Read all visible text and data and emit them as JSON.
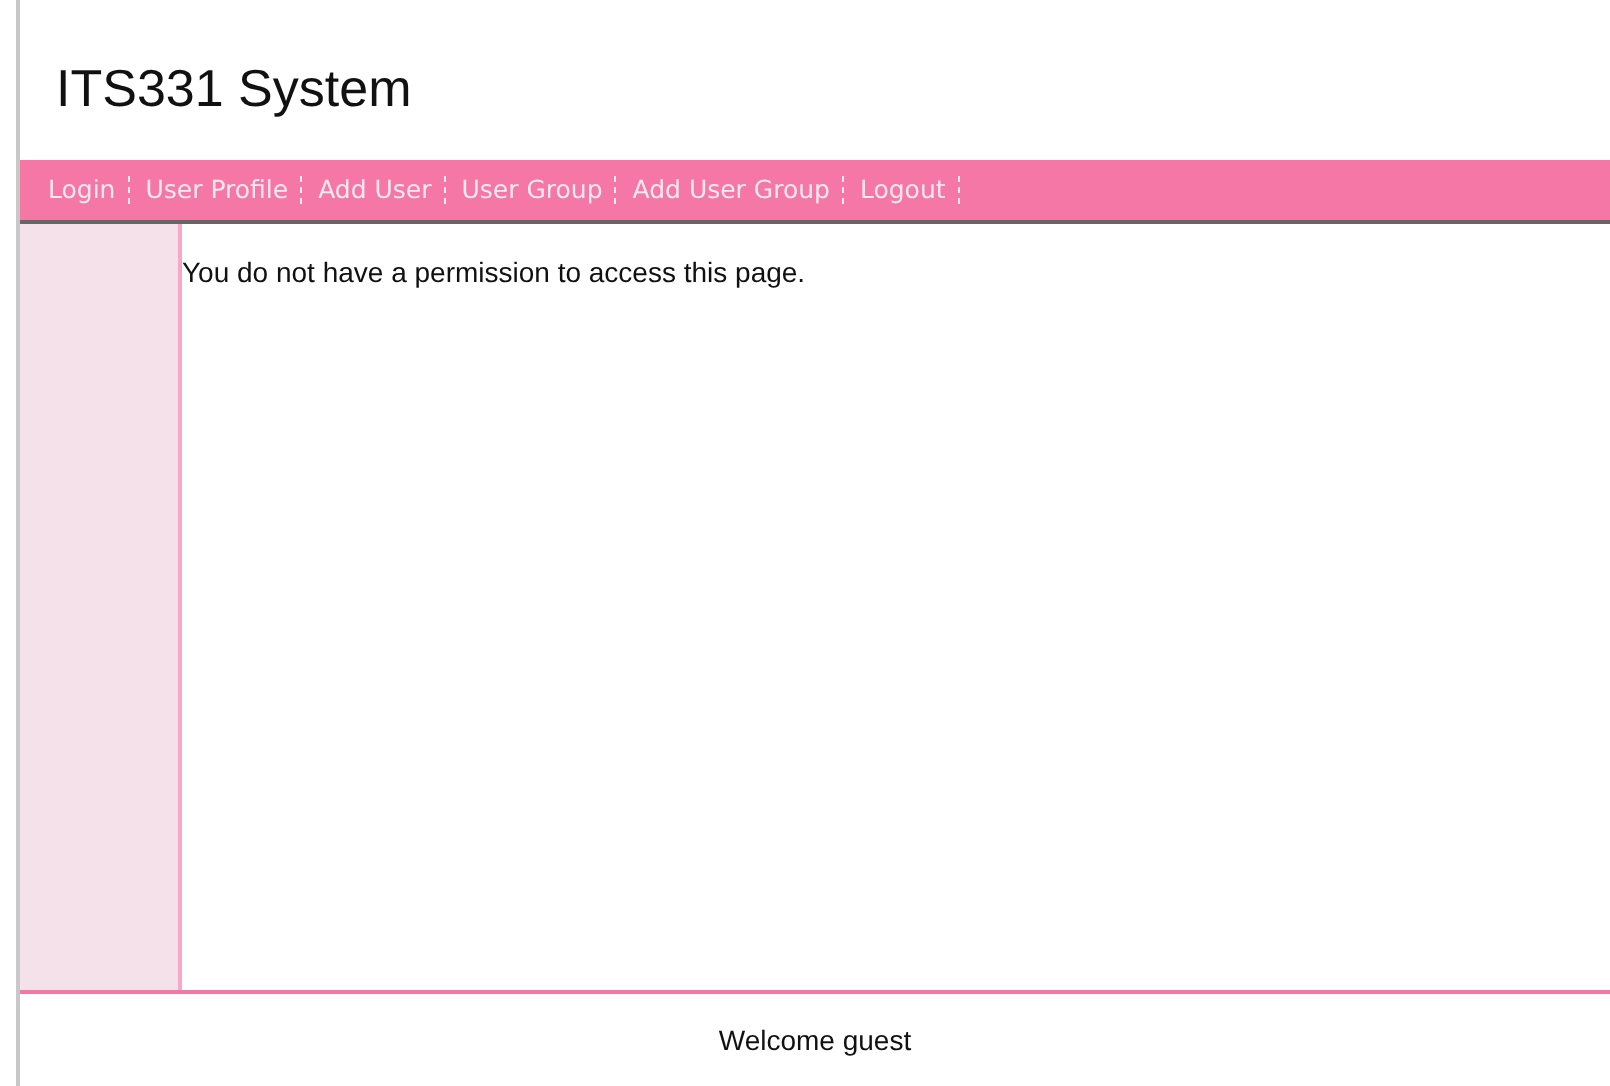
{
  "header": {
    "title": "ITS331 System"
  },
  "nav": {
    "items": [
      {
        "label": "Login"
      },
      {
        "label": "User Profile"
      },
      {
        "label": "Add User"
      },
      {
        "label": "User Group"
      },
      {
        "label": "Add User Group"
      },
      {
        "label": "Logout"
      }
    ]
  },
  "content": {
    "message": "You do not have a permission to access this page."
  },
  "footer": {
    "text": "Welcome guest"
  }
}
